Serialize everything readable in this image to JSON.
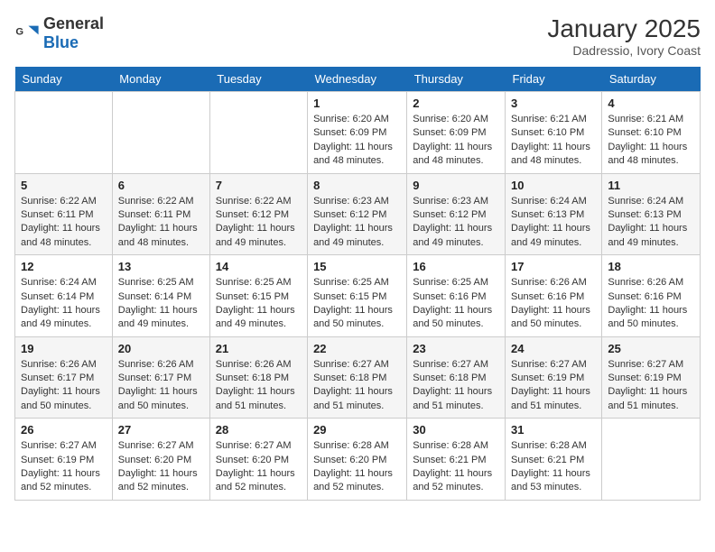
{
  "header": {
    "logo_general": "General",
    "logo_blue": "Blue",
    "month_year": "January 2025",
    "location": "Dadressio, Ivory Coast"
  },
  "days_of_week": [
    "Sunday",
    "Monday",
    "Tuesday",
    "Wednesday",
    "Thursday",
    "Friday",
    "Saturday"
  ],
  "weeks": [
    [
      {
        "day": "",
        "info": ""
      },
      {
        "day": "",
        "info": ""
      },
      {
        "day": "",
        "info": ""
      },
      {
        "day": "1",
        "info": "Sunrise: 6:20 AM\nSunset: 6:09 PM\nDaylight: 11 hours and 48 minutes."
      },
      {
        "day": "2",
        "info": "Sunrise: 6:20 AM\nSunset: 6:09 PM\nDaylight: 11 hours and 48 minutes."
      },
      {
        "day": "3",
        "info": "Sunrise: 6:21 AM\nSunset: 6:10 PM\nDaylight: 11 hours and 48 minutes."
      },
      {
        "day": "4",
        "info": "Sunrise: 6:21 AM\nSunset: 6:10 PM\nDaylight: 11 hours and 48 minutes."
      }
    ],
    [
      {
        "day": "5",
        "info": "Sunrise: 6:22 AM\nSunset: 6:11 PM\nDaylight: 11 hours and 48 minutes."
      },
      {
        "day": "6",
        "info": "Sunrise: 6:22 AM\nSunset: 6:11 PM\nDaylight: 11 hours and 48 minutes."
      },
      {
        "day": "7",
        "info": "Sunrise: 6:22 AM\nSunset: 6:12 PM\nDaylight: 11 hours and 49 minutes."
      },
      {
        "day": "8",
        "info": "Sunrise: 6:23 AM\nSunset: 6:12 PM\nDaylight: 11 hours and 49 minutes."
      },
      {
        "day": "9",
        "info": "Sunrise: 6:23 AM\nSunset: 6:12 PM\nDaylight: 11 hours and 49 minutes."
      },
      {
        "day": "10",
        "info": "Sunrise: 6:24 AM\nSunset: 6:13 PM\nDaylight: 11 hours and 49 minutes."
      },
      {
        "day": "11",
        "info": "Sunrise: 6:24 AM\nSunset: 6:13 PM\nDaylight: 11 hours and 49 minutes."
      }
    ],
    [
      {
        "day": "12",
        "info": "Sunrise: 6:24 AM\nSunset: 6:14 PM\nDaylight: 11 hours and 49 minutes."
      },
      {
        "day": "13",
        "info": "Sunrise: 6:25 AM\nSunset: 6:14 PM\nDaylight: 11 hours and 49 minutes."
      },
      {
        "day": "14",
        "info": "Sunrise: 6:25 AM\nSunset: 6:15 PM\nDaylight: 11 hours and 49 minutes."
      },
      {
        "day": "15",
        "info": "Sunrise: 6:25 AM\nSunset: 6:15 PM\nDaylight: 11 hours and 50 minutes."
      },
      {
        "day": "16",
        "info": "Sunrise: 6:25 AM\nSunset: 6:16 PM\nDaylight: 11 hours and 50 minutes."
      },
      {
        "day": "17",
        "info": "Sunrise: 6:26 AM\nSunset: 6:16 PM\nDaylight: 11 hours and 50 minutes."
      },
      {
        "day": "18",
        "info": "Sunrise: 6:26 AM\nSunset: 6:16 PM\nDaylight: 11 hours and 50 minutes."
      }
    ],
    [
      {
        "day": "19",
        "info": "Sunrise: 6:26 AM\nSunset: 6:17 PM\nDaylight: 11 hours and 50 minutes."
      },
      {
        "day": "20",
        "info": "Sunrise: 6:26 AM\nSunset: 6:17 PM\nDaylight: 11 hours and 50 minutes."
      },
      {
        "day": "21",
        "info": "Sunrise: 6:26 AM\nSunset: 6:18 PM\nDaylight: 11 hours and 51 minutes."
      },
      {
        "day": "22",
        "info": "Sunrise: 6:27 AM\nSunset: 6:18 PM\nDaylight: 11 hours and 51 minutes."
      },
      {
        "day": "23",
        "info": "Sunrise: 6:27 AM\nSunset: 6:18 PM\nDaylight: 11 hours and 51 minutes."
      },
      {
        "day": "24",
        "info": "Sunrise: 6:27 AM\nSunset: 6:19 PM\nDaylight: 11 hours and 51 minutes."
      },
      {
        "day": "25",
        "info": "Sunrise: 6:27 AM\nSunset: 6:19 PM\nDaylight: 11 hours and 51 minutes."
      }
    ],
    [
      {
        "day": "26",
        "info": "Sunrise: 6:27 AM\nSunset: 6:19 PM\nDaylight: 11 hours and 52 minutes."
      },
      {
        "day": "27",
        "info": "Sunrise: 6:27 AM\nSunset: 6:20 PM\nDaylight: 11 hours and 52 minutes."
      },
      {
        "day": "28",
        "info": "Sunrise: 6:27 AM\nSunset: 6:20 PM\nDaylight: 11 hours and 52 minutes."
      },
      {
        "day": "29",
        "info": "Sunrise: 6:28 AM\nSunset: 6:20 PM\nDaylight: 11 hours and 52 minutes."
      },
      {
        "day": "30",
        "info": "Sunrise: 6:28 AM\nSunset: 6:21 PM\nDaylight: 11 hours and 52 minutes."
      },
      {
        "day": "31",
        "info": "Sunrise: 6:28 AM\nSunset: 6:21 PM\nDaylight: 11 hours and 53 minutes."
      },
      {
        "day": "",
        "info": ""
      }
    ]
  ]
}
